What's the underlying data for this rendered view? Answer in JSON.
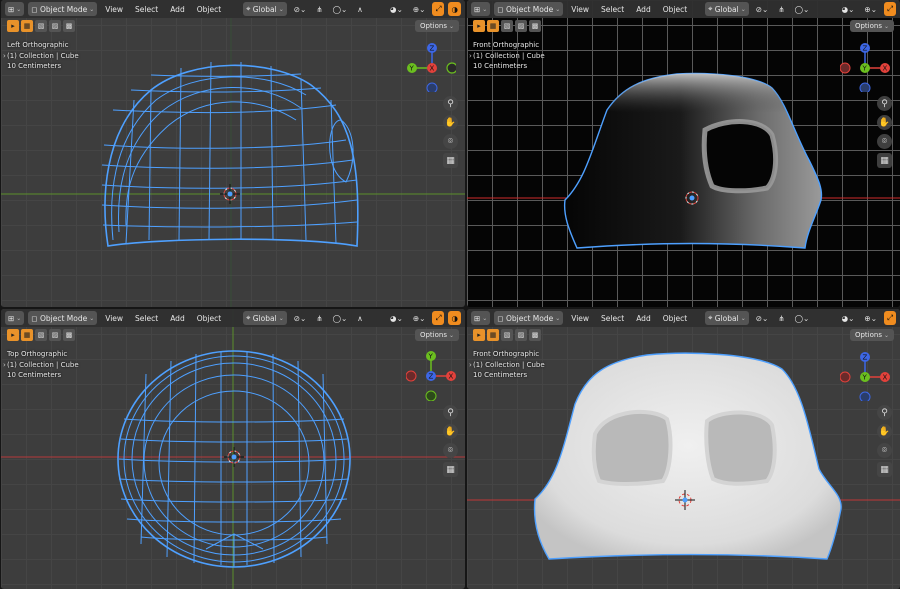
{
  "header": {
    "mode_label": "Object Mode",
    "menus": [
      "View",
      "Select",
      "Add",
      "Object"
    ],
    "transform_orientation": "Global",
    "options_label": "Options"
  },
  "viewports": {
    "top_left": {
      "view_name": "Left Orthographic",
      "collection": "(1) Collection | Cube",
      "scale": "10 Centimeters"
    },
    "top_right": {
      "view_name": "Front Orthographic",
      "collection": "(1) Collection | Cube",
      "scale": "10 Centimeters"
    },
    "bottom_left": {
      "view_name": "Top Orthographic",
      "collection": "(1) Collection | Cube",
      "scale": "10 Centimeters"
    },
    "bottom_right": {
      "view_name": "Front Orthographic",
      "collection": "(1) Collection | Cube",
      "scale": "10 Centimeters"
    }
  },
  "gizmo_labels": {
    "left": [
      "Z",
      "Y",
      "X"
    ],
    "front": [
      "Z",
      "X",
      "Y"
    ],
    "top": [
      "Y",
      "X",
      "Z"
    ]
  },
  "colors": {
    "accent": "#f08c1f",
    "selection_outline": "#4ea0ff",
    "axis_x": "#e2413b",
    "axis_y": "#6bbf1f",
    "axis_z": "#3d67e6"
  },
  "icons": [
    "cursor-icon",
    "zoom-icon",
    "hand-icon",
    "camera-icon",
    "grid-icon",
    "overlay-icon",
    "shading-icon"
  ]
}
